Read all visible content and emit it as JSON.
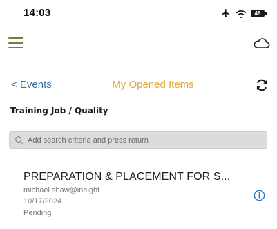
{
  "status_bar": {
    "time": "14:03",
    "battery_level": "48",
    "icons": [
      "airplane-icon",
      "wifi-icon",
      "battery-icon"
    ]
  },
  "header": {
    "menu_icon": "hamburger-menu-icon",
    "sync_icon": "cloud-icon"
  },
  "nav": {
    "back_label": "< Events",
    "title": "My Opened Items",
    "refresh_icon": "refresh-icon"
  },
  "breadcrumb": "Training Job / Quality",
  "search": {
    "value": "",
    "placeholder": "Add search criteria and press return"
  },
  "items": [
    {
      "title": "PREPARATION & PLACEMENT FOR S...",
      "user": "michael shaw@ineight",
      "date": "10/17/2024",
      "status": "Pending",
      "action_icon": "info-icon"
    }
  ],
  "colors": {
    "menu_accent": "#7b7a3c",
    "link": "#3b6ea7",
    "title_accent": "#e3a73a",
    "info_blue": "#2f6fd0",
    "search_bg": "#dcdcdc"
  }
}
